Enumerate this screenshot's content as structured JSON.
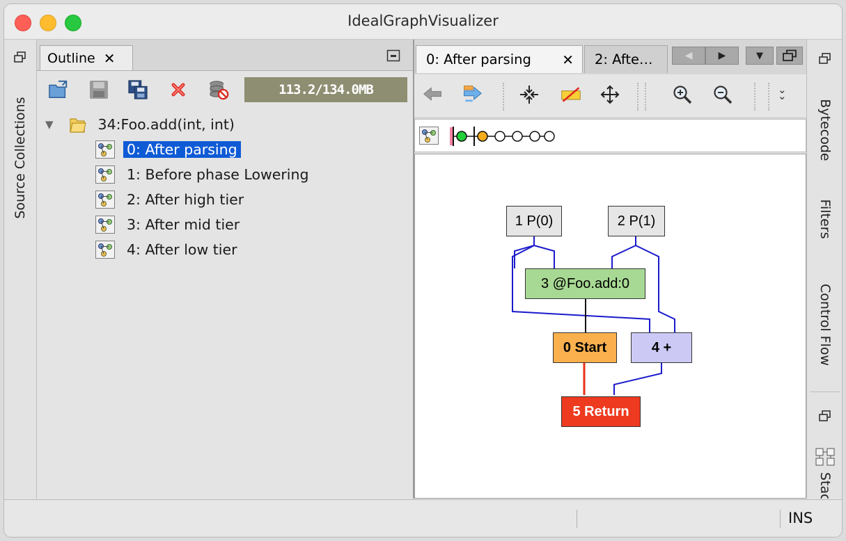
{
  "window": {
    "title": "IdealGraphVisualizer"
  },
  "left_strip": {
    "label": "Source Collections"
  },
  "outline": {
    "tab_label": "Outline",
    "memory": "113.2/134.0MB",
    "group_label": "34:Foo.add(int, int)",
    "items": [
      {
        "label": "0: After parsing"
      },
      {
        "label": "1: Before phase Lowering"
      },
      {
        "label": "2: After high tier"
      },
      {
        "label": "3: After mid tier"
      },
      {
        "label": "4: After low tier"
      }
    ]
  },
  "graph_view": {
    "tabs": [
      {
        "label": "0: After parsing"
      },
      {
        "label": "2: Afte…"
      }
    ],
    "nodes": {
      "p0": "1 P(0)",
      "p1": "2 P(1)",
      "foo": "3 @Foo.add:0",
      "start": "0 Start",
      "plus": "4 +",
      "ret": "5 Return"
    },
    "colors": {
      "param": "#e6e6e6",
      "frame": "#a8d994",
      "start": "#f9b04d",
      "plus": "#cccaf5",
      "return": "#ee3a1f",
      "edge_data": "#1a1acc",
      "edge_control": "#e83018"
    }
  },
  "right_strip": {
    "labels": [
      "Bytecode",
      "Filters",
      "Control Flow",
      "Stac"
    ]
  },
  "status_bar": {
    "mode": "INS"
  }
}
